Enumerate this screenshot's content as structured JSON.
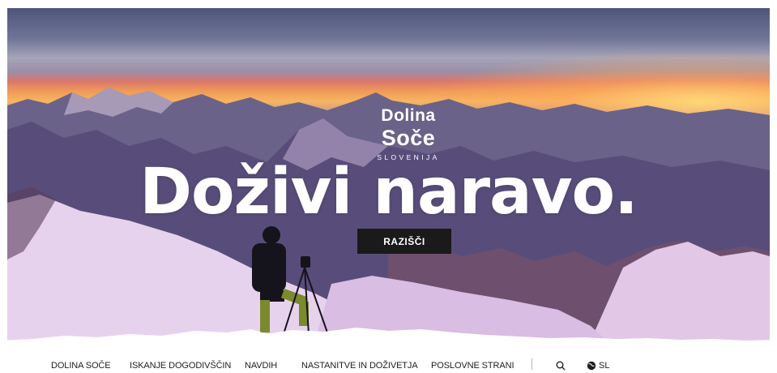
{
  "hero": {
    "logo_line1_part1": "Dolina",
    "logo_line1_part2": "Soče",
    "logo_line2": "SLOVENIJA",
    "headline": "Doživi naravo.",
    "cta_label": "RAZIŠČI"
  },
  "nav": {
    "items": [
      {
        "label": "DOLINA SOČE"
      },
      {
        "label": "ISKANJE DOGODIVŠČIN"
      },
      {
        "label": "NAVDIH"
      },
      {
        "label": "NASTANITVE IN DOŽIVETJA"
      },
      {
        "label": "POSLOVNE STRANI"
      }
    ],
    "search_icon": "search-icon",
    "language_icon": "globe-icon",
    "language_label": "SL"
  },
  "colors": {
    "cta_background": "#1a1a1a",
    "nav_text": "#1e1e1e",
    "page_background": "#ffffff"
  }
}
